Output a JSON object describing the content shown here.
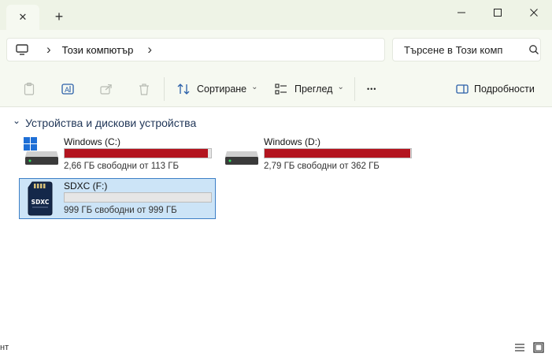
{
  "window": {
    "tab_close_glyph": "✕",
    "new_tab_glyph": "+",
    "minimize_glyph": "—",
    "maximize_glyph": "☐",
    "close_glyph": "✕"
  },
  "address": {
    "location": "Този компютър",
    "separator_glyph": "›"
  },
  "search": {
    "placeholder": "Търсене в Този комп"
  },
  "toolbar": {
    "sort_label": "Сортиране",
    "view_label": "Преглед",
    "more_glyph": "•••",
    "details_label": "Подробности",
    "chevron_glyph": "⌄"
  },
  "section": {
    "chevron_glyph": "⌄",
    "title": "Устройства и дискови устройства"
  },
  "drives": [
    {
      "name": "Windows (C:)",
      "free_text": "2,66 ГБ свободни от 113 ГБ",
      "used_fraction": 0.976,
      "bar_color": "#b3141f",
      "icon": "windows-drive-icon"
    },
    {
      "name": "Windows  (D:)",
      "free_text": "2,79 ГБ свободни от 362 ГБ",
      "used_fraction": 0.992,
      "bar_color": "#b3141f",
      "icon": "hard-drive-icon"
    },
    {
      "name": "SDXC (F:)",
      "free_text": "999 ГБ свободни от 999 ГБ",
      "used_fraction": 0.0,
      "bar_color": "#26a0da",
      "icon": "sd-card-icon",
      "sd_label": "SDXC"
    }
  ],
  "statusbar": {
    "left_text": "нт"
  },
  "colors": {
    "accent": "#3d7fc6",
    "selected_bg": "#cce4f7",
    "full_bar": "#b3141f",
    "chrome_bg": "#f6f9f1"
  }
}
